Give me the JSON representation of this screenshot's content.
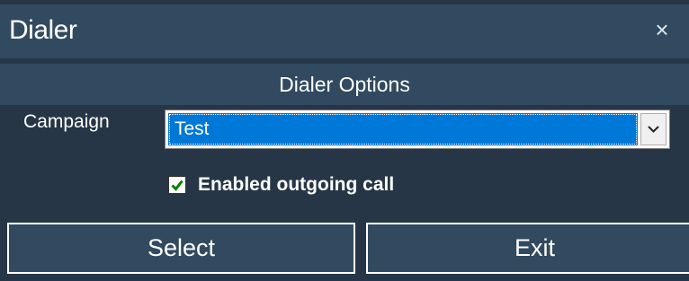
{
  "window": {
    "title": "Dialer",
    "close_glyph": "×"
  },
  "section": {
    "title": "Dialer Options"
  },
  "campaign": {
    "label": "Campaign",
    "selected": "Test"
  },
  "outgoing": {
    "label": "Enabled outgoing call",
    "checked": true
  },
  "buttons": {
    "select_label": "Select",
    "exit_label": "Exit"
  },
  "icons": {
    "close": "close-icon",
    "dropdown": "chevron-down-icon",
    "check": "checkmark-icon"
  },
  "colors": {
    "window_bg": "#263646",
    "header_bg": "#324a5f",
    "selection": "#0078d7",
    "check": "#008000"
  }
}
